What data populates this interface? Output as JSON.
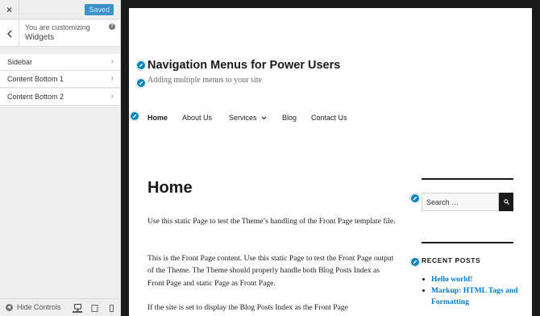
{
  "customizer": {
    "close_label": "×",
    "saved_label": "Saved",
    "context_line1": "You are customizing",
    "context_line2": "Widgets",
    "help_label": "?",
    "sections": [
      {
        "label": "Sidebar"
      },
      {
        "label": "Content Bottom 1"
      },
      {
        "label": "Content Bottom 2"
      }
    ],
    "chevron": "›",
    "footer": {
      "hide_controls_label": "Hide Controls",
      "devices": [
        "desktop",
        "tablet",
        "mobile"
      ]
    }
  },
  "preview": {
    "site_title": "Navigation Menus for Power Users",
    "site_description": "Adding multiple menus to your site",
    "nav": [
      "Home",
      "About Us",
      "Services",
      "Blog",
      "Contact Us"
    ],
    "page_title": "Home",
    "paragraphs": [
      "Use this static Page to test the Theme’s handling of the Front Page template file.",
      "This is the Front Page content. Use this static Page to test the Front Page output of the Theme. The Theme should properly handle both Blog Posts Index as Front Page and static Page as Front Page.",
      "If the site is set to display the Blog Posts Index as the Front Page"
    ],
    "search": {
      "placeholder": "Search …"
    },
    "recent_posts": {
      "heading": "RECENT POSTS",
      "items": [
        "Hello world!",
        "Markup: HTML Tags and Formatting"
      ]
    }
  },
  "colors": {
    "accent": "#0085ba",
    "saved_button": "#3c91c6",
    "link": "#007acc",
    "frame": "#1a1a1a"
  }
}
